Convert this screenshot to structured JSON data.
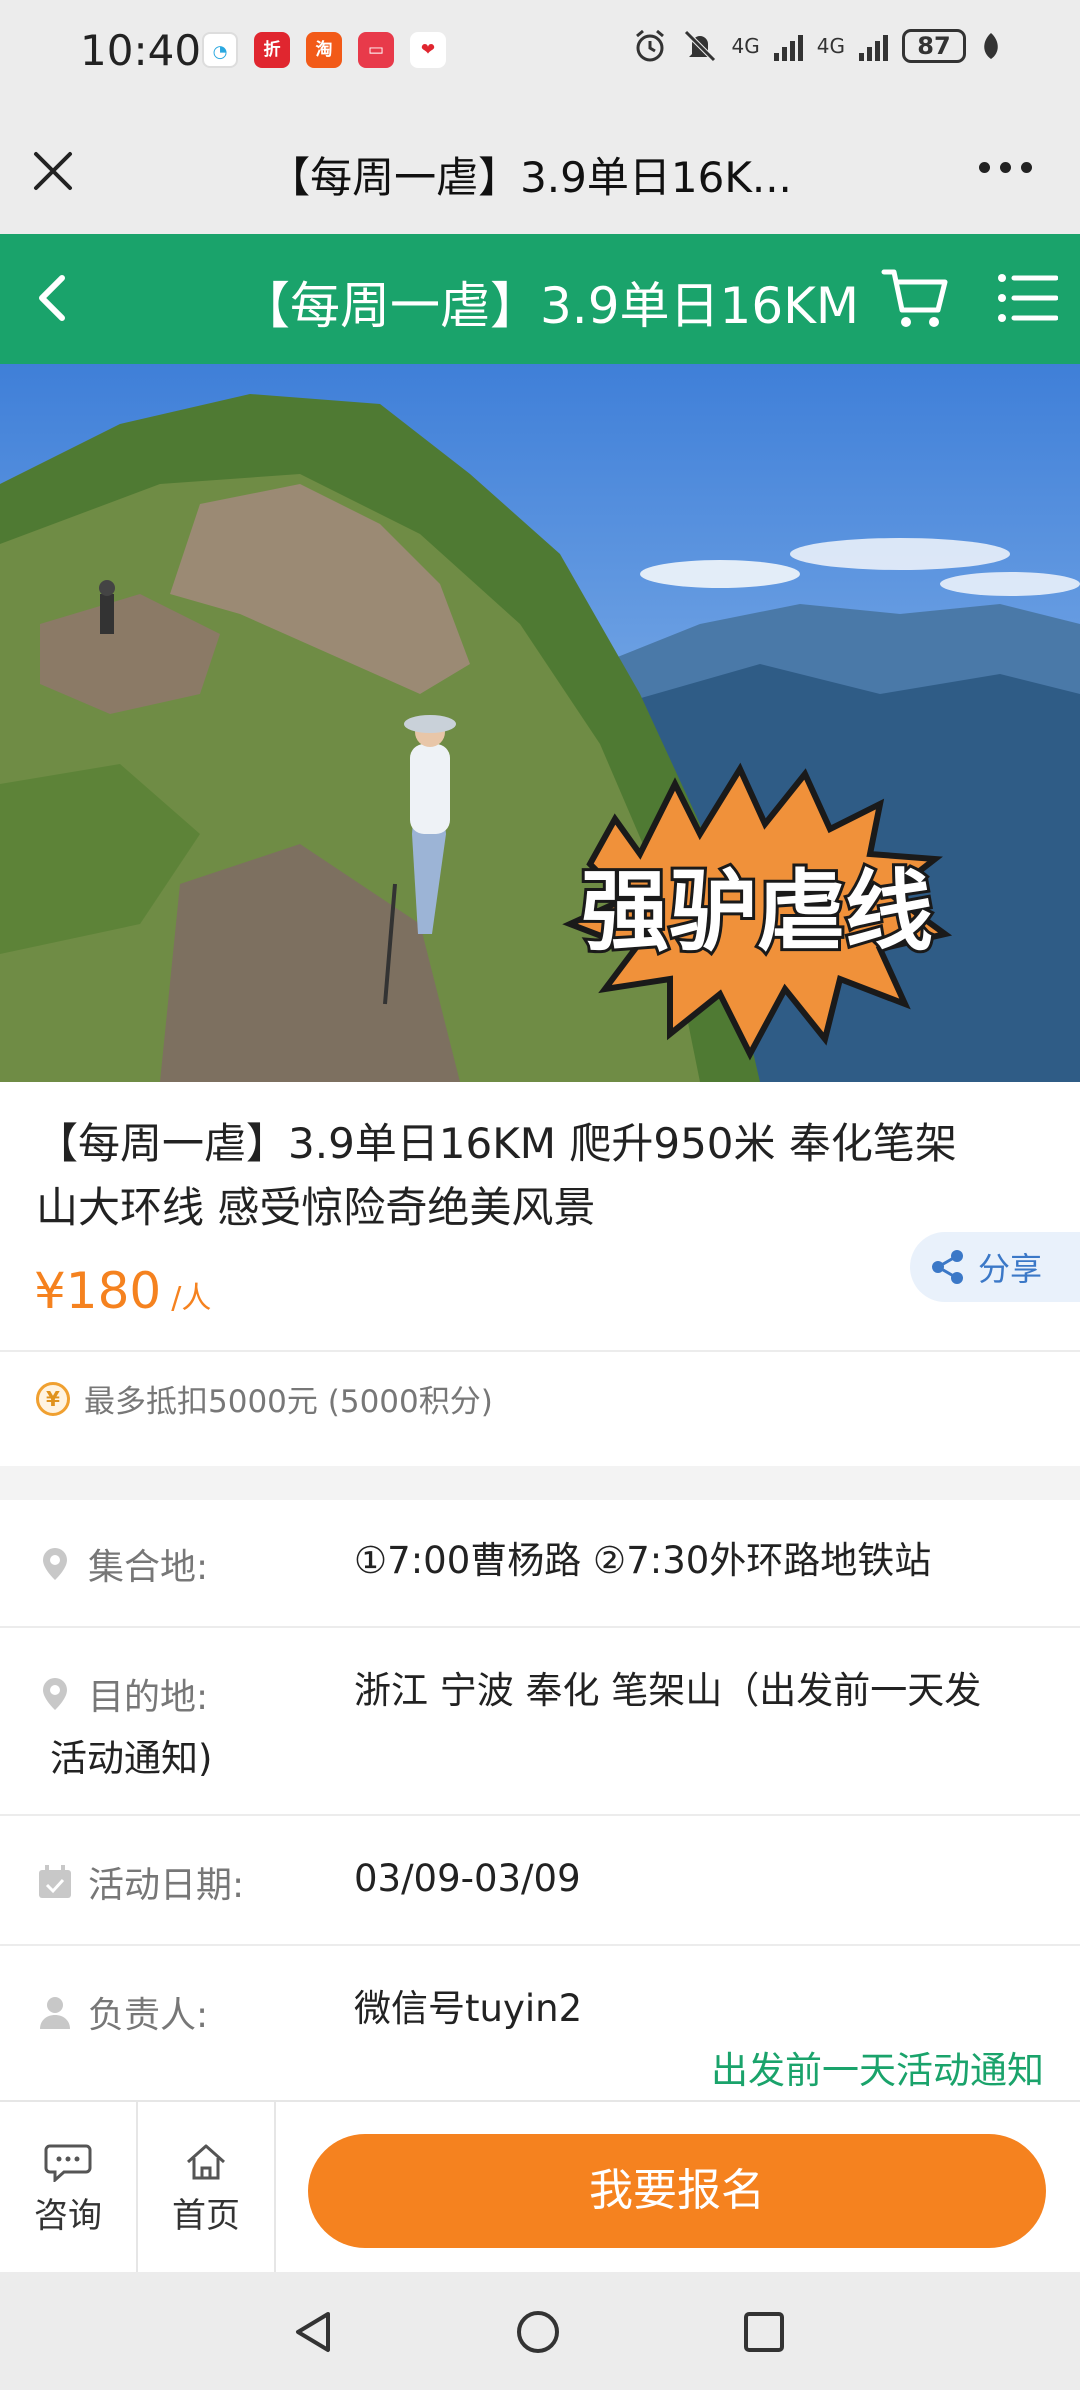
{
  "status_bar": {
    "time": "10:40",
    "network_1": "4G",
    "network_2": "4G",
    "battery": "87"
  },
  "webview": {
    "title": "【每周一虐】3.9单日16K..."
  },
  "header": {
    "title": "【每周一虐】3.9单日16KM"
  },
  "hero": {
    "badge_text": "强驴虐线"
  },
  "product": {
    "title_line1": "【每周一虐】3.9单日16KM 爬升950米 奉化笔架",
    "title_line2": "山大环线 感受惊险奇绝美风景",
    "price": "¥180",
    "price_unit": "/人",
    "share_label": "分享",
    "points_text": "最多抵扣5000元 (5000积分)"
  },
  "info": {
    "assembly_label": "集合地:",
    "assembly_value": "①7:00曹杨路 ②7:30外环路地铁站",
    "destination_label": "目的地:",
    "destination_value_line1": "浙江 宁波 奉化 笔架山（出发前一天发",
    "destination_value_line2": "活动通知)",
    "date_label": "活动日期:",
    "date_value": "03/09-03/09",
    "leader_label": "负责人:",
    "leader_value": "微信号tuyin2",
    "notice": "出发前一天活动通知"
  },
  "bottom": {
    "consult_label": "咨询",
    "home_label": "首页",
    "signup_label": "我要报名"
  },
  "colors": {
    "brand_green": "#1aa36b",
    "accent_orange": "#f5821f",
    "share_blue": "#3b78c7"
  }
}
